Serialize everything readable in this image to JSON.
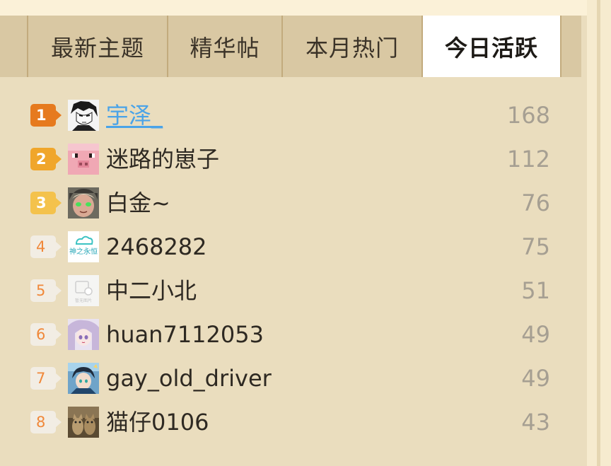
{
  "tabs": [
    {
      "label": "最新主题",
      "active": false
    },
    {
      "label": "精华帖",
      "active": false
    },
    {
      "label": "本月热门",
      "active": false
    },
    {
      "label": "今日活跃",
      "active": true
    }
  ],
  "colors": {
    "panel_bg": "#eaddbe",
    "tab_bar_bg": "#d9c8a3",
    "active_tab_bg": "#ffffff",
    "rank1": "#e67a1e",
    "rank2": "#f0a62b",
    "rank3": "#f4c24c",
    "link": "#4aa3e8",
    "count": "#a69f92"
  },
  "ranking": [
    {
      "rank": "1",
      "name": "宇泽_",
      "count": "168",
      "avatar": "manga-boy-avatar"
    },
    {
      "rank": "2",
      "name": "迷路的崽子",
      "count": "112",
      "avatar": "pig-avatar"
    },
    {
      "rank": "3",
      "name": "白金~",
      "count": "76",
      "avatar": "green-eyes-avatar"
    },
    {
      "rank": "4",
      "name": "2468282",
      "count": "75",
      "avatar": "cloud-logo-avatar"
    },
    {
      "rank": "5",
      "name": "中二小北",
      "count": "51",
      "avatar": "default-avatar"
    },
    {
      "rank": "6",
      "name": "huan7112053",
      "count": "49",
      "avatar": "anime-girl-avatar"
    },
    {
      "rank": "7",
      "name": "gay_old_driver",
      "count": "49",
      "avatar": "anime-boy-avatar"
    },
    {
      "rank": "8",
      "name": "猫仔0106",
      "count": "43",
      "avatar": "cats-avatar"
    }
  ],
  "avatar_texts": {
    "cloud_logo": "神之永恒",
    "default_placeholder": "暂无图片"
  }
}
